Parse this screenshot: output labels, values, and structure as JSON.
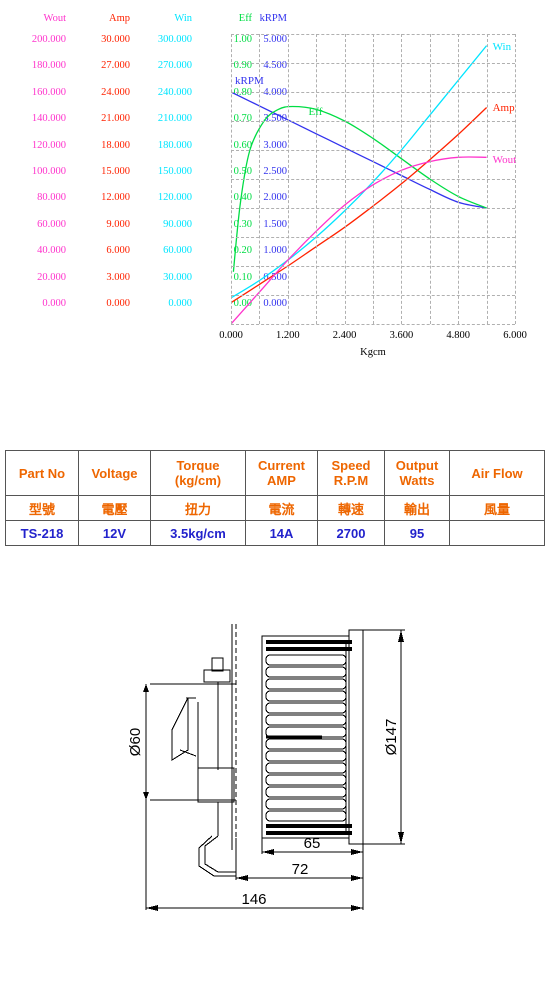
{
  "chart_data": {
    "type": "line",
    "title": "",
    "xlabel": "Kgcm",
    "xlim": [
      0,
      6
    ],
    "xticks": [
      "0.000",
      "1.200",
      "2.400",
      "3.600",
      "4.800",
      "6.000"
    ],
    "grid": true,
    "legend_position": "inline-right",
    "axes": [
      {
        "name": "Wout",
        "color": "#ff33cc",
        "header": "Wout",
        "ticks": [
          "200.000",
          "180.000",
          "160.000",
          "140.000",
          "120.000",
          "100.000",
          "80.000",
          "60.000",
          "40.000",
          "20.000",
          "0.000"
        ]
      },
      {
        "name": "Amp",
        "color": "#ff2200",
        "header": "Amp",
        "ticks": [
          "30.000",
          "27.000",
          "24.000",
          "21.000",
          "18.000",
          "15.000",
          "12.000",
          "9.000",
          "6.000",
          "3.000",
          "0.000"
        ]
      },
      {
        "name": "Win",
        "color": "#00e5ff",
        "header": "Win",
        "ticks": [
          "300.000",
          "270.000",
          "240.000",
          "210.000",
          "180.000",
          "150.000",
          "120.000",
          "90.000",
          "60.000",
          "30.000",
          "0.000"
        ]
      },
      {
        "name": "Eff",
        "color": "#00dd44",
        "header": "Eff",
        "ticks": [
          "1.00",
          "0.90",
          "0.80",
          "0.70",
          "0.60",
          "0.50",
          "0.40",
          "0.30",
          "0.20",
          "0.10",
          "0.00"
        ]
      },
      {
        "name": "kRPM",
        "color": "#3333ee",
        "header": "kRPM",
        "ticks": [
          "5.000",
          "4.500",
          "4.000",
          "3.500",
          "3.000",
          "2.500",
          "2.000",
          "1.500",
          "1.000",
          "0.500",
          "0.000"
        ]
      }
    ],
    "series": [
      {
        "name": "kRPM",
        "color": "#3333ee",
        "label": "kRPM",
        "unit": "kRPM",
        "x": [
          0.0,
          0.6,
          1.2,
          1.8,
          2.4,
          3.0,
          3.6,
          4.2,
          4.8,
          5.4
        ],
        "y": [
          4.0,
          3.76,
          3.52,
          3.28,
          3.04,
          2.8,
          2.56,
          2.32,
          2.1,
          2.0
        ]
      },
      {
        "name": "Eff",
        "color": "#00dd44",
        "label": "Eff",
        "unit": "",
        "x": [
          0.05,
          0.2,
          0.4,
          0.7,
          1.0,
          1.3,
          1.8,
          2.4,
          3.0,
          3.6,
          4.2,
          4.8,
          5.4
        ],
        "y": [
          0.18,
          0.42,
          0.6,
          0.7,
          0.74,
          0.75,
          0.74,
          0.7,
          0.64,
          0.57,
          0.5,
          0.44,
          0.4
        ]
      },
      {
        "name": "Win",
        "color": "#00e5ff",
        "label": "Win",
        "unit": "W",
        "x": [
          0.0,
          0.6,
          1.2,
          1.8,
          2.4,
          3.0,
          3.6,
          4.2,
          4.8,
          5.4
        ],
        "y": [
          27,
          45,
          66,
          90,
          117,
          147,
          180,
          216,
          252,
          288
        ]
      },
      {
        "name": "Amp",
        "color": "#ff2200",
        "label": "Amp",
        "unit": "A",
        "x": [
          0.0,
          0.6,
          1.2,
          1.8,
          2.4,
          3.0,
          3.6,
          4.2,
          4.8,
          5.4
        ],
        "y": [
          2.2,
          4.1,
          6.0,
          8.0,
          10.0,
          12.2,
          14.5,
          17.0,
          19.6,
          22.4
        ]
      },
      {
        "name": "Wout",
        "color": "#ff33cc",
        "label": "Wout",
        "unit": "W",
        "x": [
          0.0,
          0.6,
          1.2,
          1.8,
          2.4,
          3.0,
          3.6,
          4.2,
          4.8,
          5.4
        ],
        "y": [
          0,
          22,
          44,
          64,
          82,
          96,
          106,
          112,
          115,
          115
        ]
      }
    ]
  },
  "table": {
    "headers_en": [
      "Part No",
      "Voltage",
      "Torque\n(kg/cm)",
      "Current\nAMP",
      "Speed\nR.P.M",
      "Output\nWatts",
      "Air  Flow"
    ],
    "h_part_no": "Part No",
    "h_voltage": "Voltage",
    "h_torque1": "Torque",
    "h_torque2": "(kg/cm)",
    "h_current1": "Current",
    "h_current2": "AMP",
    "h_speed1": "Speed",
    "h_speed2": "R.P.M",
    "h_output1": "Output",
    "h_output2": "Watts",
    "h_airflow": "Air  Flow",
    "cn_part_no": "型號",
    "cn_voltage": "電壓",
    "cn_torque": "扭力",
    "cn_current": "電流",
    "cn_speed": "轉速",
    "cn_output": "輸出",
    "cn_airflow": "風量",
    "v_part_no": "TS-218",
    "v_voltage": "12V",
    "v_torque": "3.5kg/cm",
    "v_current": "14A",
    "v_speed": "2700",
    "v_output": "95",
    "v_airflow": ""
  },
  "drawing": {
    "dim_diameter_motor": "Ø60",
    "dim_diameter_fan": "Ø147",
    "dim_width_fan": "65",
    "dim_width_mid": "72",
    "dim_width_total": "146"
  },
  "colors": {
    "wout": "#ff33cc",
    "amp": "#ff2200",
    "win": "#00e5ff",
    "eff": "#00dd44",
    "krpm": "#3333ee",
    "table_header": "#ee6600",
    "table_value": "#2222cc",
    "grid": "#b0b0b0"
  }
}
